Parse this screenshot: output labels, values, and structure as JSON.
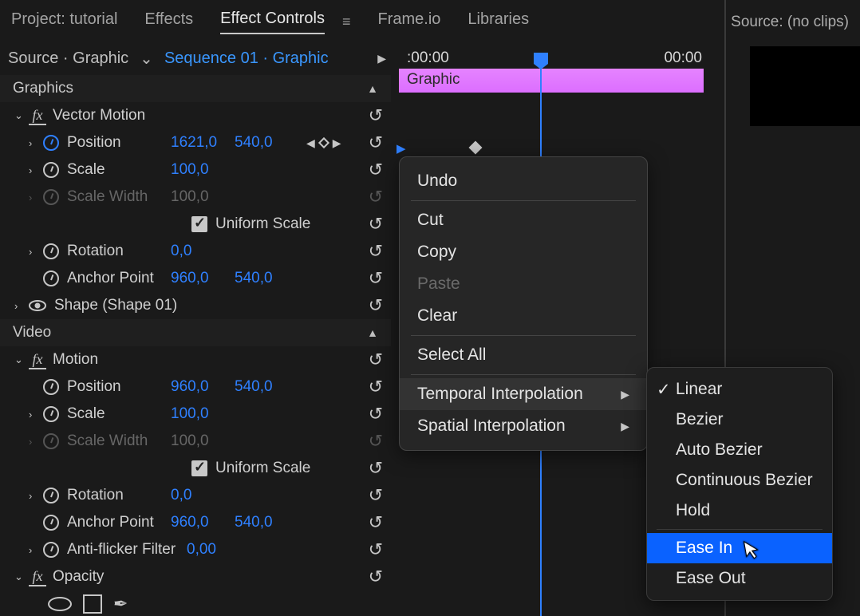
{
  "tabs": {
    "project": "Project: tutorial",
    "effects": "Effects",
    "effect_controls": "Effect Controls",
    "frameio": "Frame.io",
    "libraries": "Libraries"
  },
  "source_label": "Source: (no clips)",
  "breadcrumb": {
    "source": "Source · Graphic",
    "sequence": "Sequence 01 · Graphic"
  },
  "sections": {
    "graphics": "Graphics",
    "video": "Video"
  },
  "vector_motion": {
    "label": "Vector Motion",
    "position": {
      "label": "Position",
      "x": "1621,0",
      "y": "540,0"
    },
    "scale": {
      "label": "Scale",
      "val": "100,0"
    },
    "scale_width": {
      "label": "Scale Width",
      "val": "100,0"
    },
    "uniform": "Uniform Scale",
    "rotation": {
      "label": "Rotation",
      "val": "0,0"
    },
    "anchor": {
      "label": "Anchor Point",
      "x": "960,0",
      "y": "540,0"
    }
  },
  "shape": {
    "label": "Shape (Shape 01)"
  },
  "motion": {
    "label": "Motion",
    "position": {
      "label": "Position",
      "x": "960,0",
      "y": "540,0"
    },
    "scale": {
      "label": "Scale",
      "val": "100,0"
    },
    "scale_width": {
      "label": "Scale Width",
      "val": "100,0"
    },
    "uniform": "Uniform Scale",
    "rotation": {
      "label": "Rotation",
      "val": "0,0"
    },
    "anchor": {
      "label": "Anchor Point",
      "x": "960,0",
      "y": "540,0"
    },
    "antiflicker": {
      "label": "Anti-flicker Filter",
      "val": "0,00"
    }
  },
  "opacity": {
    "label": "Opacity"
  },
  "timeline": {
    "start": ":00:00",
    "end": "00:00",
    "clip": "Graphic"
  },
  "context_menu": {
    "undo": "Undo",
    "cut": "Cut",
    "copy": "Copy",
    "paste": "Paste",
    "clear": "Clear",
    "select_all": "Select All",
    "temporal": "Temporal Interpolation",
    "spatial": "Spatial Interpolation"
  },
  "submenu": {
    "linear": "Linear",
    "bezier": "Bezier",
    "auto_bezier": "Auto Bezier",
    "continuous_bezier": "Continuous Bezier",
    "hold": "Hold",
    "ease_in": "Ease In",
    "ease_out": "Ease Out"
  }
}
